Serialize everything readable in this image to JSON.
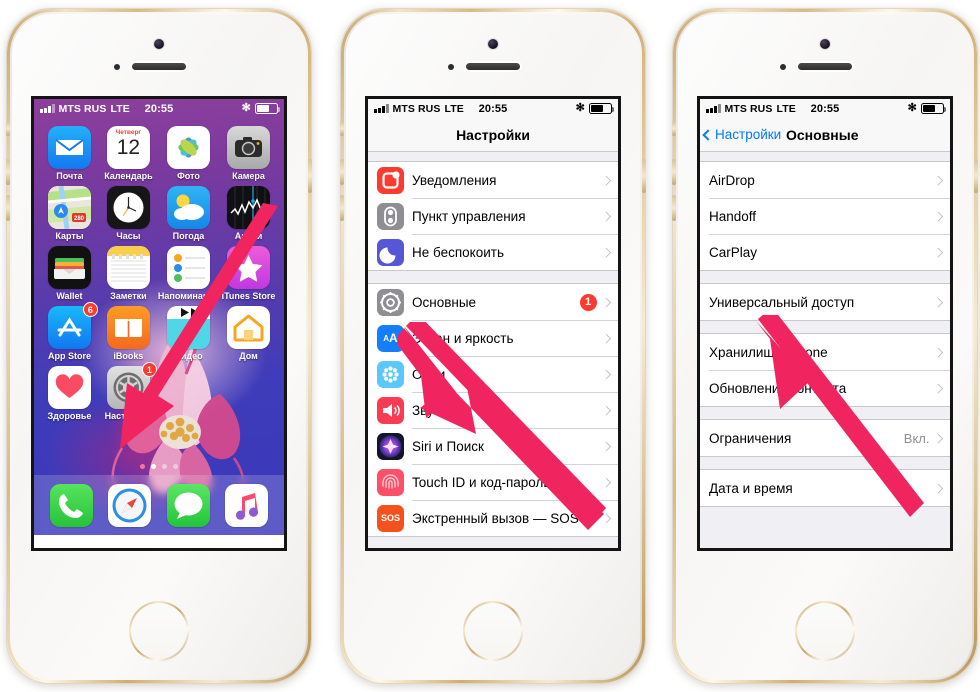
{
  "accent": {
    "arrow": "#f0255f",
    "badge_red": "#fb3b30",
    "link_blue": "#007aff"
  },
  "status_bar": {
    "carrier": "MTS RUS",
    "network": "LTE",
    "time": "20:55",
    "bluetooth_icon": "bluetooth-icon",
    "battery_icon": "battery-icon",
    "signal_icon": "signal-bars-icon"
  },
  "phone1": {
    "name": "home-screen",
    "rows": [
      [
        {
          "label": "Почта",
          "icon": "mail-icon"
        },
        {
          "label": "Календарь",
          "icon": "calendar-icon",
          "day": "12",
          "weekday": "Четверг"
        },
        {
          "label": "Фото",
          "icon": "photos-icon"
        },
        {
          "label": "Камера",
          "icon": "camera-icon"
        }
      ],
      [
        {
          "label": "Карты",
          "icon": "maps-icon",
          "shield": "280"
        },
        {
          "label": "Часы",
          "icon": "clock-icon"
        },
        {
          "label": "Погода",
          "icon": "weather-icon"
        },
        {
          "label": "Акции",
          "icon": "stocks-icon"
        }
      ],
      [
        {
          "label": "Wallet",
          "icon": "wallet-icon"
        },
        {
          "label": "Заметки",
          "icon": "notes-icon"
        },
        {
          "label": "Напоминания",
          "icon": "reminders-icon"
        },
        {
          "label": "iTunes Store",
          "icon": "itunes-store-icon"
        }
      ],
      [
        {
          "label": "App Store",
          "icon": "app-store-icon",
          "badge": "6"
        },
        {
          "label": "iBooks",
          "icon": "ibooks-icon"
        },
        {
          "label": "Видео",
          "icon": "videos-icon"
        },
        {
          "label": "Дом",
          "icon": "home-app-icon"
        }
      ],
      [
        {
          "label": "Здоровье",
          "icon": "health-icon"
        },
        {
          "label": "Настройки",
          "icon": "settings-gear-icon",
          "badge": "1"
        }
      ]
    ],
    "dock": [
      {
        "label": "Телефон",
        "icon": "phone-icon"
      },
      {
        "label": "Safari",
        "icon": "safari-icon"
      },
      {
        "label": "Сообщения",
        "icon": "messages-icon"
      },
      {
        "label": "Музыка",
        "icon": "music-icon"
      }
    ],
    "page_dots": {
      "count": 4,
      "active_index": 1
    }
  },
  "phone2": {
    "nav_title": "Настройки",
    "groups": [
      {
        "rows": [
          {
            "label": "Уведомления",
            "icon": "notifications-icon",
            "color": "#fb3b30"
          },
          {
            "label": "Пункт управления",
            "icon": "control-center-icon",
            "color": "#8e8e93"
          },
          {
            "label": "Не беспокоить",
            "icon": "do-not-disturb-icon",
            "color": "#5756d6"
          }
        ]
      },
      {
        "rows": [
          {
            "label": "Основные",
            "icon": "general-gear-icon",
            "color": "#8e8e93",
            "badge": "1"
          },
          {
            "label": "Экран и яркость",
            "icon": "display-brightness-icon",
            "color": "#157efb"
          },
          {
            "label": "Обои",
            "icon": "wallpaper-icon",
            "color": "#5ac8fa"
          },
          {
            "label": "Звуки",
            "icon": "sounds-icon",
            "color": "#fb3b52"
          },
          {
            "label": "Siri и Поиск",
            "icon": "siri-icon",
            "color": "#1c1c3a"
          },
          {
            "label": "Touch ID и код-пароль",
            "icon": "touch-id-icon",
            "color": "#fb3b52"
          },
          {
            "label": "Экстренный вызов — SOS",
            "icon": "sos-icon",
            "color": "#f4511e"
          }
        ]
      }
    ]
  },
  "phone3": {
    "back_label": "Настройки",
    "nav_title": "Основные",
    "groups": [
      {
        "rows": [
          {
            "label": "AirDrop"
          },
          {
            "label": "Handoff"
          },
          {
            "label": "CarPlay"
          }
        ]
      },
      {
        "rows": [
          {
            "label": "Универсальный доступ"
          }
        ]
      },
      {
        "rows": [
          {
            "label": "Хранилище iPhone"
          },
          {
            "label": "Обновление контента"
          }
        ]
      },
      {
        "rows": [
          {
            "label": "Ограничения",
            "value": "Вкл."
          }
        ]
      },
      {
        "rows": [
          {
            "label": "Дата и время"
          }
        ]
      }
    ]
  },
  "annotations": [
    {
      "name": "arrow-to-settings-app",
      "target": "Настройки"
    },
    {
      "name": "arrow-to-general-row",
      "target": "Основные"
    },
    {
      "name": "arrow-to-accessibility-row",
      "target": "Универсальный доступ"
    }
  ]
}
